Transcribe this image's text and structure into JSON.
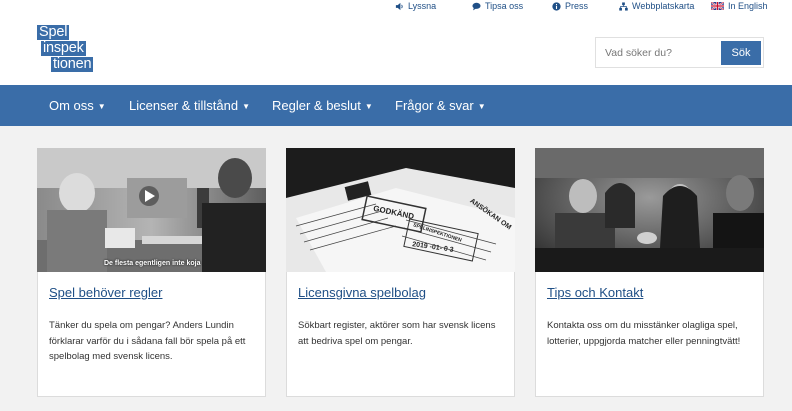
{
  "utility": {
    "listen": "Lyssna",
    "tip": "Tipsa oss",
    "press": "Press",
    "sitemap": "Webbplatskarta",
    "english": "In English"
  },
  "logo": {
    "line1": "Spel",
    "line2": "inspek",
    "line3": "tionen"
  },
  "search": {
    "placeholder": "Vad söker du?",
    "button": "Sök"
  },
  "nav": [
    {
      "label": "Om oss"
    },
    {
      "label": "Licenser & tillstånd"
    },
    {
      "label": "Regler & beslut"
    },
    {
      "label": "Frågor & svar"
    }
  ],
  "cards": [
    {
      "title": "Spel behöver regler",
      "description": "Tänker du spela om pengar? Anders Lundin förklarar varför du i sådana fall bör spela på ett spelbolag med svensk licens.",
      "image_caption": "De flesta egentligen inte koja"
    },
    {
      "title": "Licensgivna spelbolag",
      "description": "Sökbart register, aktörer som har svensk licens att bedriva spel om pengar.",
      "stamp": "GODKÄND",
      "doc_header": "SPELINSPEKTIONEN",
      "doc_date": "2019 -01- 0 3",
      "doc_title": "ANSÖKAN OM"
    },
    {
      "title": "Tips och Kontakt",
      "description": "Kontakta oss om du misstänker olagliga spel, lotterier, uppgjorda matcher eller penningtvätt!"
    }
  ],
  "colors": {
    "brand": "#3a6da8",
    "link": "#1f4f86"
  }
}
